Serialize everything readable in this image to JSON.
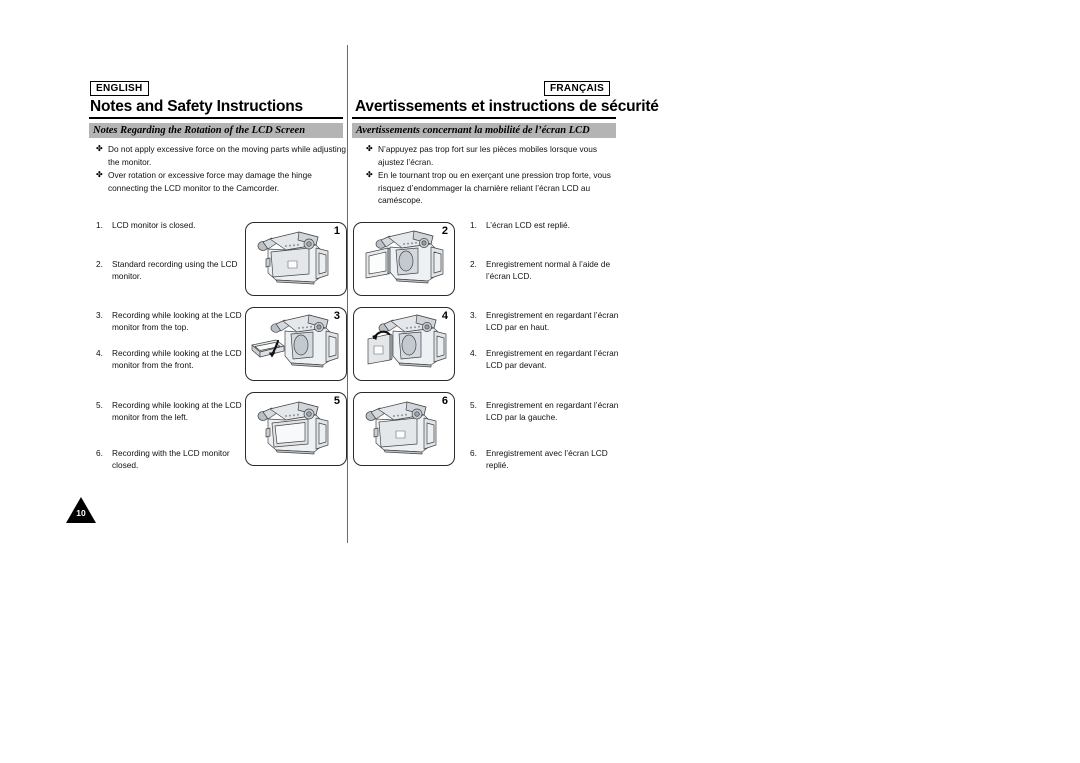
{
  "document": {
    "page_number": "10"
  },
  "left_column": {
    "language_tag": "ENGLISH",
    "heading": "Notes and Safety Instructions",
    "section_title": "Notes Regarding the Rotation of the LCD Screen",
    "bullets": [
      "Do not apply excessive force on the moving parts while adjusting the monitor.",
      "Over rotation or excessive force may damage the hinge connecting the LCD monitor to the Camcorder."
    ],
    "steps": [
      {
        "index": "1.",
        "text": "LCD monitor is closed."
      },
      {
        "index": "2.",
        "text": "Standard recording using the LCD monitor."
      },
      {
        "index": "3.",
        "text": "Recording while looking at the LCD monitor from the top."
      },
      {
        "index": "4.",
        "text": "Recording while looking at the LCD monitor from the front."
      },
      {
        "index": "5.",
        "text": "Recording while looking at the LCD monitor from the left."
      },
      {
        "index": "6.",
        "text": "Recording with the LCD monitor closed."
      }
    ]
  },
  "right_column": {
    "language_tag": "FRANÇAIS",
    "heading": "Avertissements et instructions de sécurité",
    "section_title": "Avertissements concernant la mobilité de l’écran LCD",
    "bullets": [
      "N’appuyez pas trop fort sur les pièces mobiles lorsque vous ajustez l’écran.",
      "En le tournant trop ou en exerçant une pression trop forte, vous risquez d’endommager la charnière reliant l’écran LCD au caméscope."
    ],
    "steps": [
      {
        "index": "1.",
        "text": "L’écran LCD est replié."
      },
      {
        "index": "2.",
        "text": "Enregistrement normal à l’aide de l’écran LCD."
      },
      {
        "index": "3.",
        "text": "Enregistrement en regardant l’écran LCD par en haut."
      },
      {
        "index": "4.",
        "text": "Enregistrement en regardant l’écran LCD par devant."
      },
      {
        "index": "5.",
        "text": "Enregistrement en regardant l’écran LCD par la gauche."
      },
      {
        "index": "6.",
        "text": "Enregistrement avec l’écran LCD replié."
      }
    ]
  },
  "figures": [
    {
      "label": "1",
      "caption_key": "lcd-closed-rear-view"
    },
    {
      "label": "2",
      "caption_key": "lcd-open-standard"
    },
    {
      "label": "3",
      "caption_key": "lcd-rotated-from-top"
    },
    {
      "label": "4",
      "caption_key": "lcd-rotated-from-front"
    },
    {
      "label": "5",
      "caption_key": "lcd-facing-left"
    },
    {
      "label": "6",
      "caption_key": "lcd-closed-outward"
    }
  ],
  "bullet_marker": "✤",
  "colors": {
    "band_gray": "#b4b4b4",
    "rule_black": "#000000",
    "divider_gray": "#6b6b6b",
    "body_camera": "#e9ecef",
    "shade_camera": "#c8ced4"
  }
}
